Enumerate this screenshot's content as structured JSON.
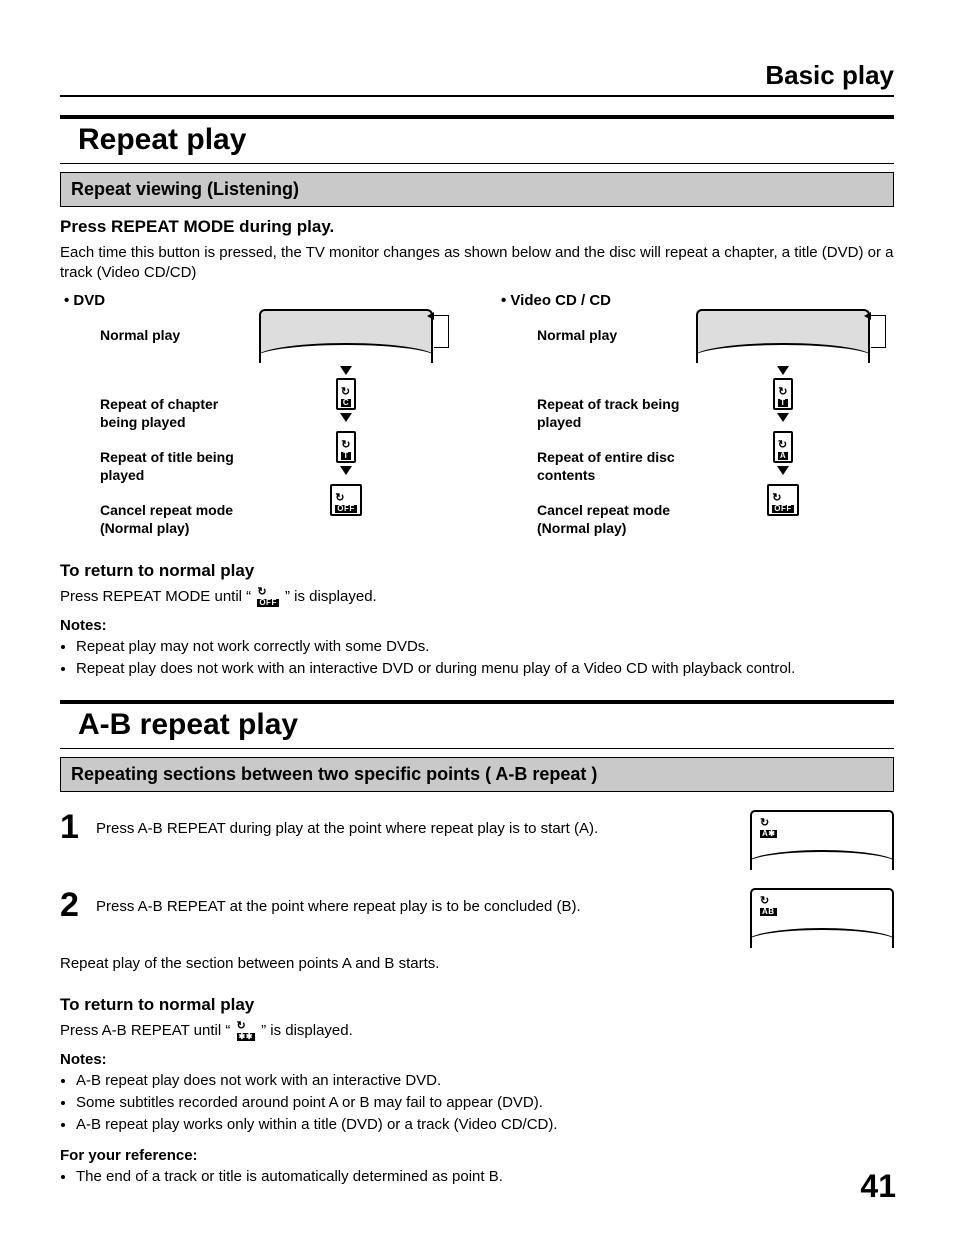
{
  "header": {
    "breadcrumb": "Basic play"
  },
  "repeat": {
    "title": "Repeat play",
    "subhead": "Repeat viewing (Listening)",
    "instr_head": "Press REPEAT MODE during play.",
    "instr_body": "Each time this button is pressed, the TV monitor changes as shown below and the disc will repeat a chapter, a title (DVD) or a track (Video CD/CD)",
    "dvd": {
      "head": "• DVD",
      "states": [
        {
          "label": "Normal play",
          "tag": ""
        },
        {
          "label": "Repeat of chapter being played",
          "tag": "C"
        },
        {
          "label": "Repeat of title being played",
          "tag": "T"
        },
        {
          "label": "Cancel repeat mode (Normal play)",
          "tag": "OFF"
        }
      ]
    },
    "vcd": {
      "head": "• Video CD / CD",
      "states": [
        {
          "label": "Normal play",
          "tag": ""
        },
        {
          "label": "Repeat of track being played",
          "tag": "T"
        },
        {
          "label": "Repeat of entire disc contents",
          "tag": "A"
        },
        {
          "label": "Cancel repeat mode (Normal play)",
          "tag": "OFF"
        }
      ]
    },
    "return_head": "To return to normal play",
    "return_pre": "Press REPEAT MODE until “ ",
    "return_icon_tag": "OFF",
    "return_post": " ” is displayed.",
    "notes_head": "Notes:",
    "notes": [
      "Repeat play may not work correctly with some DVDs.",
      "Repeat play does not work with an interactive DVD or during menu play of a Video CD with playback control."
    ]
  },
  "ab": {
    "title": "A-B repeat play",
    "subhead": "Repeating sections between two specific points ( A-B repeat )",
    "step1_num": "1",
    "step1_text": "Press A-B REPEAT during play at the point where repeat play is to start (A).",
    "step1_tag": "A✱",
    "step2_num": "2",
    "step2_text": "Press A-B REPEAT at the point where repeat play is to be concluded (B).",
    "step2_tag": "AB",
    "after2": "Repeat play of the section between points A and B starts.",
    "return_head": "To return to normal play",
    "return_pre": "Press A-B REPEAT until “ ",
    "return_icon_tag": "✱✱",
    "return_post": " ” is displayed.",
    "notes_head": "Notes:",
    "notes": [
      "A-B repeat play does not work with an interactive DVD.",
      "Some subtitles recorded around point A or B may fail to appear (DVD).",
      "A-B repeat play works only within a title (DVD) or a track (Video CD/CD)."
    ],
    "ref_head": "For your reference:",
    "ref": [
      "The end of a track or title is automatically determined as point B."
    ]
  },
  "page_number": "41"
}
